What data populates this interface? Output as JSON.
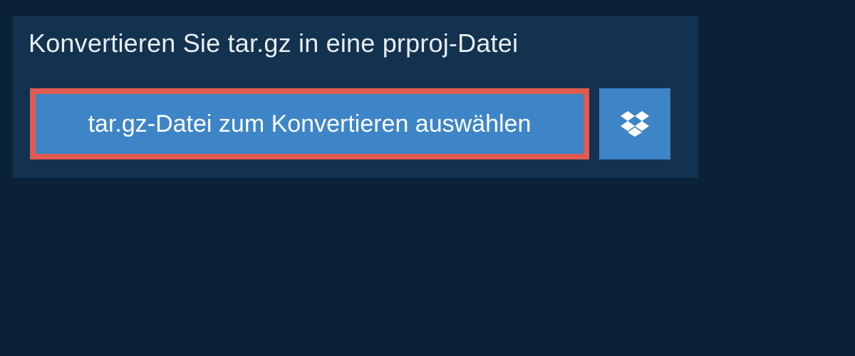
{
  "heading": "Konvertieren Sie tar.gz in eine prproj-Datei",
  "file_button": {
    "label": "tar.gz-Datei zum Konvertieren auswählen"
  }
}
